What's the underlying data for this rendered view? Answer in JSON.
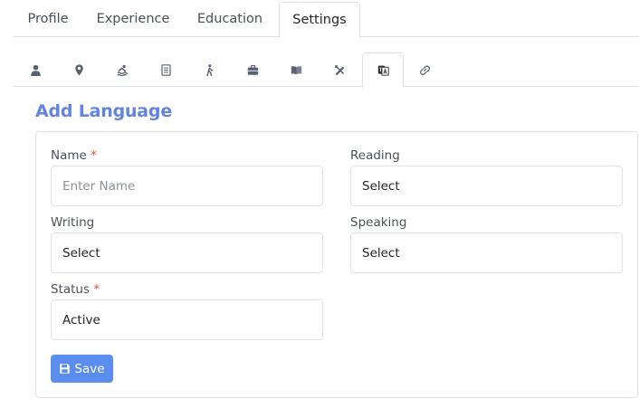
{
  "top_tabs": [
    {
      "label": "Profile"
    },
    {
      "label": "Experience"
    },
    {
      "label": "Education"
    },
    {
      "label": "Settings"
    }
  ],
  "icon_tabs": [
    {
      "icon": "user-icon"
    },
    {
      "icon": "map-marker-icon"
    },
    {
      "icon": "swimmer-icon"
    },
    {
      "icon": "document-icon"
    },
    {
      "icon": "walking-icon"
    },
    {
      "icon": "briefcase-icon"
    },
    {
      "icon": "book-open-icon"
    },
    {
      "icon": "drafting-tools-icon"
    },
    {
      "icon": "language-icon"
    },
    {
      "icon": "link-icon"
    }
  ],
  "active_top_tab": "Settings",
  "active_icon_tab": "language-icon",
  "form": {
    "title": "Add Language",
    "name": {
      "label": "Name",
      "required_mark": "*",
      "placeholder": "Enter Name",
      "value": ""
    },
    "reading": {
      "label": "Reading",
      "value": "Select"
    },
    "writing": {
      "label": "Writing",
      "value": "Select"
    },
    "speaking": {
      "label": "Speaking",
      "value": "Select"
    },
    "status": {
      "label": "Status",
      "required_mark": "*",
      "value": "Active"
    },
    "save_label": "Save"
  },
  "colors": {
    "accent": "#6184e0",
    "button": "#5b8def",
    "required": "#e74c3c"
  }
}
